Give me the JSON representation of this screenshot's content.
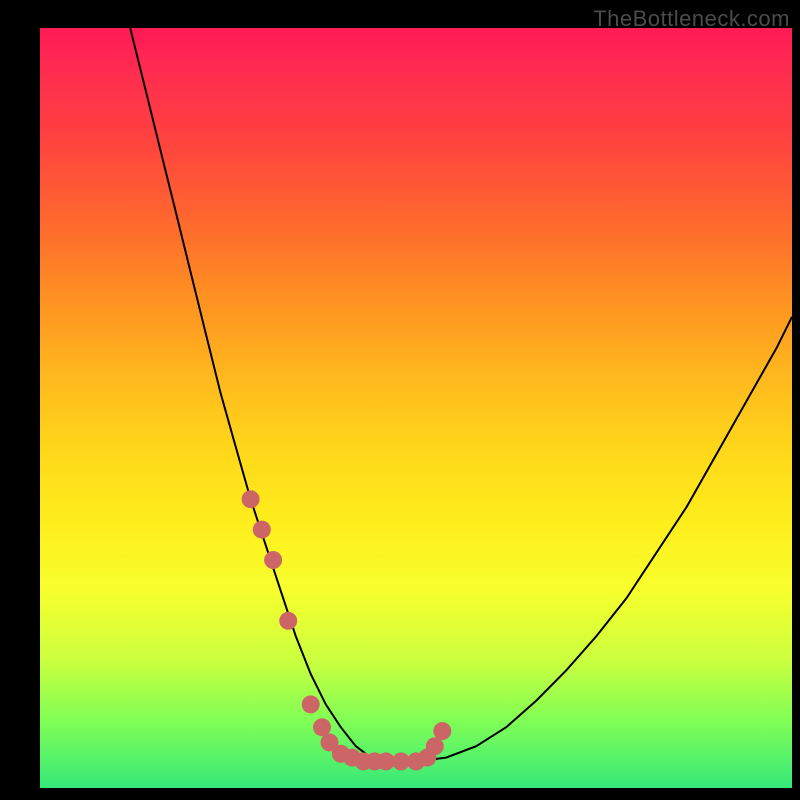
{
  "watermark": "TheBottleneck.com",
  "colors": {
    "background": "#000000",
    "curve": "#000000",
    "marker": "#cc6666",
    "gradient_top": "#ff1a55",
    "gradient_bottom": "#35e879"
  },
  "chart_data": {
    "type": "line",
    "title": "",
    "xlabel": "",
    "ylabel": "",
    "xlim": [
      0,
      100
    ],
    "ylim": [
      0,
      100
    ],
    "note": "Bottleneck-style V curve: a steep descent from the top-left to a flat trough near the bottom center, then a shallower climb to the right. Y-axis is inverted visually (0 at top, 100 at bottom). Values are estimated from unlabeled axes.",
    "series": [
      {
        "name": "curve",
        "x": [
          12,
          14,
          16,
          18,
          20,
          22,
          24,
          26,
          28,
          30,
          32,
          34,
          36,
          38,
          40,
          42,
          44,
          46,
          48,
          50,
          54,
          58,
          62,
          66,
          70,
          74,
          78,
          82,
          86,
          90,
          94,
          98,
          100
        ],
        "y": [
          0,
          8,
          16,
          24,
          32,
          40,
          48,
          55,
          62,
          68,
          74,
          80,
          85,
          89,
          92,
          94.5,
          96,
          96.5,
          96.5,
          96.5,
          96,
          94.5,
          92,
          88.5,
          84.5,
          80,
          75,
          69,
          63,
          56,
          49,
          42,
          38
        ]
      }
    ],
    "markers": {
      "name": "highlighted-points",
      "color": "#cc6666",
      "x": [
        28,
        29.5,
        31,
        33,
        36,
        37.5,
        38.5,
        40,
        41.5,
        43,
        44.5,
        46,
        48,
        50,
        51.5,
        52.5,
        53.5
      ],
      "y": [
        62,
        66,
        70,
        78,
        89,
        92,
        94,
        95.5,
        96,
        96.5,
        96.5,
        96.5,
        96.5,
        96.5,
        96,
        94.5,
        92.5
      ]
    }
  }
}
